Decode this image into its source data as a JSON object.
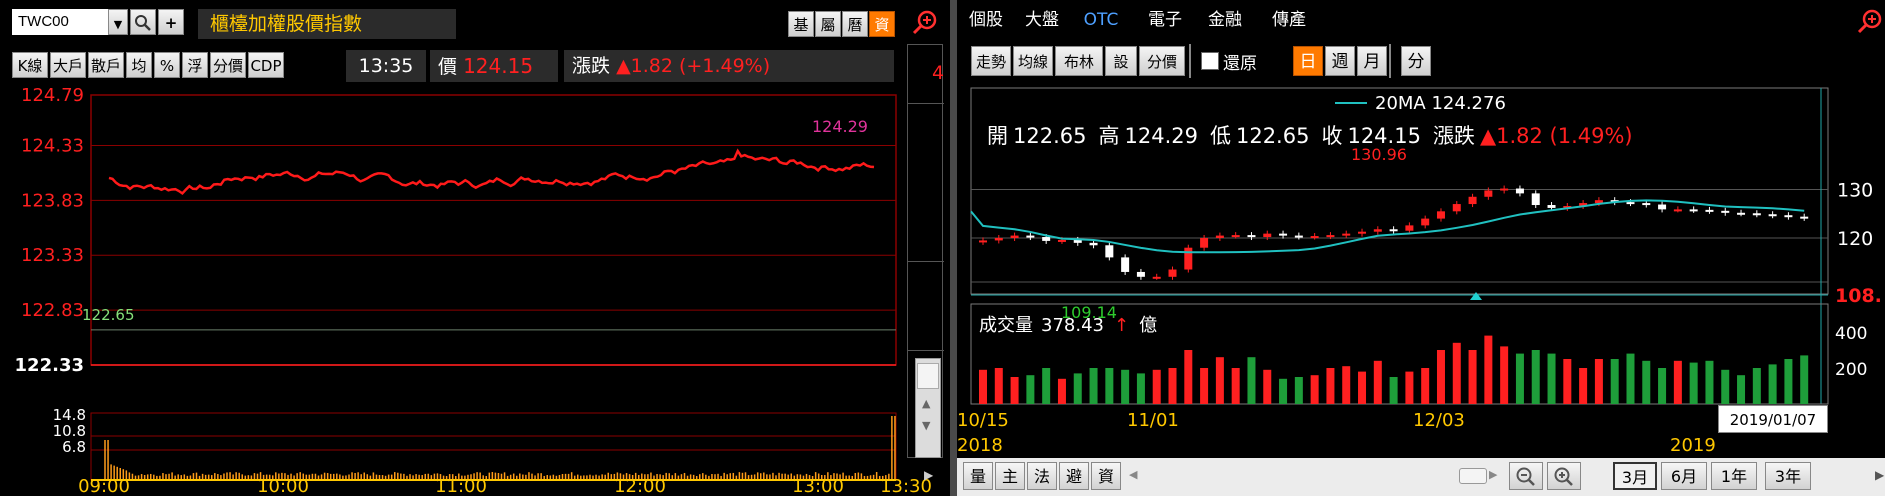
{
  "left": {
    "symbol": "TWC00",
    "title": "櫃檯加權股價指數",
    "side_tabs": [
      "基",
      "屬",
      "曆",
      "資"
    ],
    "side_tab_active": 3,
    "toolbar": [
      "K線",
      "大戶",
      "散戶",
      "均",
      "%",
      "浮",
      "分價",
      "CDP"
    ],
    "time": "13:35",
    "price_label": "價",
    "price": "124.15",
    "change_label": "漲跌",
    "change": "▲1.82 (+1.49%)",
    "edge_mark": "4",
    "y_labels": [
      "124.79",
      "124.33",
      "123.83",
      "123.33",
      "122.83",
      "122.33"
    ],
    "prev_close_label": "122.65",
    "high_label": "124.29",
    "vol_labels": [
      "14.8",
      "10.8",
      "6.8"
    ],
    "x_labels": [
      "09:00",
      "10:00",
      "11:00",
      "12:00",
      "13:00",
      "13:30"
    ],
    "colors": {
      "price_line": "#ff1a1a",
      "label_red": "#ff2020",
      "grid": "#8b0000",
      "axis_gold": "#ffc800",
      "vol": "#ff9c1a"
    }
  },
  "right": {
    "tabs": [
      "個股",
      "大盤",
      "OTC",
      "電子",
      "金融",
      "傳產"
    ],
    "active_tab": 2,
    "toolbar": [
      "走勢",
      "均線",
      "布林",
      "設",
      "分價"
    ],
    "restore_label": "還原",
    "periods": [
      "日",
      "週",
      "月"
    ],
    "active_period": 0,
    "minute_label": "分",
    "ma_label": "20MA 124.276",
    "ohlc": {
      "open_label": "開",
      "open": "122.65",
      "high_label": "高",
      "high": "124.29",
      "low_label": "低",
      "low": "122.65",
      "close_label": "收",
      "close": "124.15",
      "change_label": "漲跌",
      "change": "▲1.82 (1.49%)"
    },
    "max_label": "130.96",
    "min_label": "109.14",
    "y_labels": [
      "130",
      "120"
    ],
    "crop_price": "108.",
    "volume_label": "成交量",
    "volume_value": "378.43",
    "volume_unit": "億",
    "vol_y_labels": [
      "400",
      "200"
    ],
    "x_labels": [
      "10/15",
      "11/01",
      "12/03"
    ],
    "year_labels": [
      "2018",
      "2019"
    ],
    "cursor_date": "2019/01/07",
    "bottom_tabs": [
      "量",
      "主",
      "法",
      "避",
      "資"
    ],
    "ranges": [
      "3月",
      "6月",
      "1年",
      "3年"
    ],
    "active_range": 0
  }
}
